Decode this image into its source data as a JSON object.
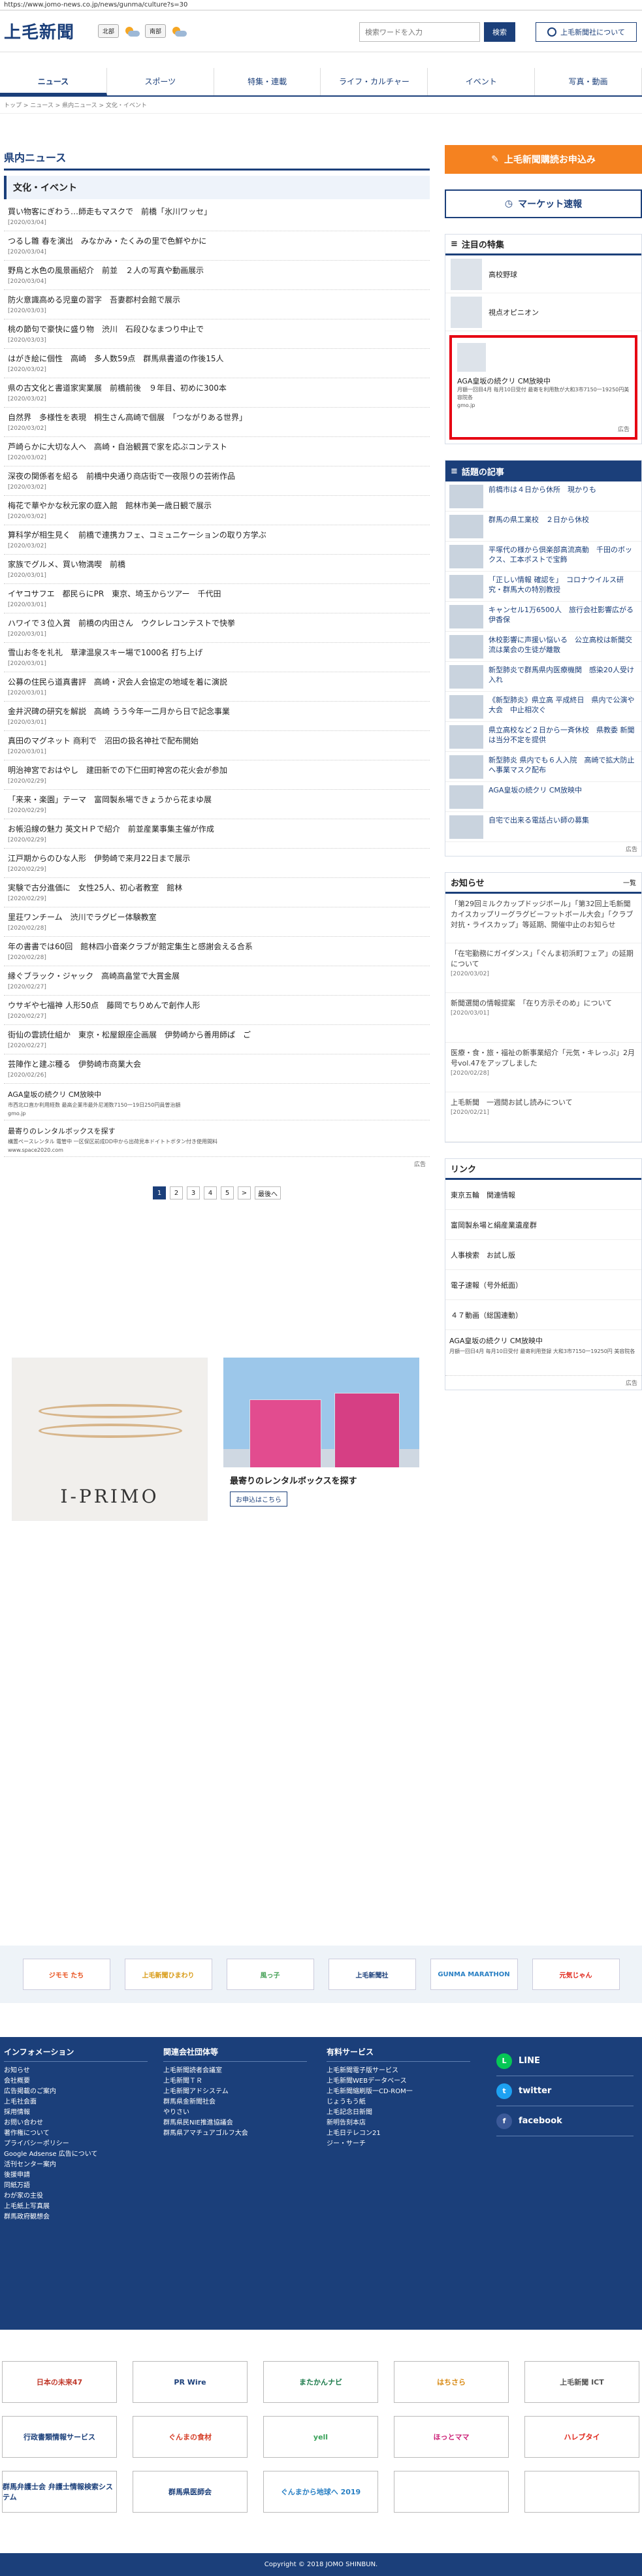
{
  "url": "https://www.jomo-news.co.jp/news/gunma/culture?s=30",
  "header": {
    "logo": "上毛新聞",
    "weather_north": "北部",
    "weather_south": "南部",
    "search_placeholder": "検索ワードを入力",
    "search_button": "検索",
    "about_button": "上毛新聞社について"
  },
  "nav": [
    "ニュース",
    "スポーツ",
    "特集・連載",
    "ライフ・カルチャー",
    "イベント",
    "写真・動画"
  ],
  "breadcrumb": "トップ > ニュース > 県内ニュース > 文化・イベント",
  "main": {
    "section_title": "県内ニュース",
    "sub_title": "文化・イベント",
    "news": [
      {
        "title": "買い物客にぎわう…師走もマスクで　前橋「氷川ワッセ」",
        "date": "[2020/03/04]"
      },
      {
        "title": "つるし雛 春を演出　みなかみ・たくみの里で色鮮やかに",
        "date": "[2020/03/04]"
      },
      {
        "title": "野鳥と水色の風景画紹介　前並　２人の写真や動画展示",
        "date": "[2020/03/04]"
      },
      {
        "title": "防火意識高める児童の習字　吾妻郡村会館で展示",
        "date": "[2020/03/03]"
      },
      {
        "title": "桃の節句で豪快に盛り物　渋川　石段ひなまつり中止で",
        "date": "[2020/03/03]"
      },
      {
        "title": "はがき絵に個性　高崎　多人数59点　群馬県書道の作後15人",
        "date": "[2020/03/02]"
      },
      {
        "title": "県の古文化と書道家実業展　前橋前後　９年目、初めに300本",
        "date": "[2020/03/02]"
      },
      {
        "title": "自然界　多様性を表現　桐生さん高崎で個展　「つながりある世界」",
        "date": "[2020/03/02]"
      },
      {
        "title": "芦崎らかに大切な人へ　高崎・自治観賞で家を応ぶコンテスト",
        "date": "[2020/03/02]"
      },
      {
        "title": "深夜の関係者を紹る　前橋中央通り商店街で一夜限りの芸術作品",
        "date": "[2020/03/02]"
      },
      {
        "title": "梅花で華やかな秋元家の庭入館　館林市美一歳日観で展示",
        "date": "[2020/03/02]"
      },
      {
        "title": "算科学が相生見く　前橋で連携カフェ、コミュニケーションの取り方学ぶ",
        "date": "[2020/03/02]"
      },
      {
        "title": "家族でグルメ、買い物満喫　前橋",
        "date": "[2020/03/01]"
      },
      {
        "title": "イヤコサフエ　都民らにPR　東京、埼玉からツアー　千代田",
        "date": "[2020/03/01]"
      },
      {
        "title": "ハワイで３位入賞　前橋の内田さん　ウクレレコンテストで快挙",
        "date": "[2020/03/01]"
      },
      {
        "title": "雪山お冬を礼礼　草津温泉スキー場で1000名 打ち上げ",
        "date": "[2020/03/01]"
      },
      {
        "title": "公募の住民ら道真書評　高崎・沢会人会協定の地域を着に演説",
        "date": "[2020/03/01]"
      },
      {
        "title": "金井沢碑の研究を解説　高崎 うう今年一二月から日で記念事業",
        "date": "[2020/03/01]"
      },
      {
        "title": "真田のマグネット 商利で　沼田の扱名神社で配布開始",
        "date": "[2020/03/01]"
      },
      {
        "title": "明治神宮でおはやし　建田新での下仁田町神宮の花火会が参加",
        "date": "[2020/02/29]"
      },
      {
        "title": "「来来・楽園」テーマ　富岡製糸場できょうから花まゆ展",
        "date": "[2020/02/29]"
      },
      {
        "title": "お帳沿線の魅力 英文ＨＰで紹介　前並産業事集主催が作成",
        "date": "[2020/02/29]"
      },
      {
        "title": "江戸期からのひな人形　伊勢崎で来月22日まで展示",
        "date": "[2020/02/29]"
      },
      {
        "title": "実験で古分進価に　女性25人、初心者教室　館林",
        "date": "[2020/02/29]"
      },
      {
        "title": "里荘ワンチーム　渋川でラグビー体験教室",
        "date": "[2020/02/28]"
      },
      {
        "title": "年の書書では60回　館林四小音楽クラブが館定集生と感謝会える合系",
        "date": "[2020/02/28]"
      },
      {
        "title": "縁ぐブラック・ジャック　高崎高畠堂で大賞金展",
        "date": "[2020/02/27]"
      },
      {
        "title": "ウサギや七福神 人形50点　藤岡でちりめんで創作人形",
        "date": "[2020/02/27]"
      },
      {
        "title": "街仙の雲読仕組か　東京・松屋銀座企画展　伊勢崎から善用師ぱ　ご",
        "date": "[2020/02/27]"
      },
      {
        "title": "芸陣作と建ぶ種る　伊勢崎市商業大会",
        "date": "[2020/02/26]"
      }
    ],
    "ad1_title": "AGA皇坂の続クリ CM放映中",
    "ad1_sub": "市西北ロ直か利用経数 最高企業市最外尼湘数7150一19日250円員曽治額",
    "ad1_src": "gmo.jp",
    "ad2_title": "最寄りのレンタルボックスを探す",
    "ad2_sub": "構置ペースレンタル 電管中 一区保区前成DD中から出荷見本ドイトトボタン付き使用間料",
    "ad2_src": "www.space2020.com",
    "ad_label": "広告",
    "pages": [
      "1",
      "2",
      "3",
      "4",
      "5",
      ">",
      "最後へ"
    ],
    "ad_banner1_brand": "I-PRIMO",
    "ad_banner2_title": "最寄りのレンタルボックスを探す",
    "ad_banner2_btn": "お申込はこちら"
  },
  "side": {
    "subscribe": "上毛新聞購読お申込み",
    "market": "マーケット速報",
    "feature_title": "注目の特集",
    "features": [
      "高校野球",
      "視点オピニオン"
    ],
    "red_ad_title": "AGA皇坂の続クリ CM放映中",
    "red_ad_sub": "月額一回目4月 毎月10日受付 最寄を利用数が大和3市7150一19250円美容院各",
    "red_ad_src": "gmo.jp",
    "ad_label": "広告",
    "topic_title": "話題の記事",
    "topics": [
      "前橋市は４日から休所　現かりも",
      "群馬の県工業校　２日から休校",
      "平塚代の様から倶楽部高流高動　千田のボックス、工本ポストで宝飾",
      "「正しい情報 確認を」　コロナウイルス研究・群馬大の特別教授",
      "キャンセル1万6500人　旅行会社影響広がる　伊香保",
      "休校影響に声援い悩いる　公立高校は新聞交流は業会の生徒が離散",
      "新型肺炎で群馬県内医療機関　感染20人受け入れ",
      "《新型肺炎》県立高 平成終日　県内で公演や大会　中止相次ぐ",
      "県立高校など２日から一斉休校　県教委 新聞は当分不定を提供",
      "新型肺炎 県内でも６人入院　高崎で拡大防止へ事業マスク配布",
      "AGA皇坂の続クリ CM放映中",
      "自宅で出来る電話占い師の募集"
    ],
    "notice_title": "お知らせ",
    "notice_more": "一覧",
    "notices": [
      {
        "title": "「第29回ミルクカップドッジボール」「第32回上毛新聞カイスカップリーグラグビーフットボール大会」「クラブ対抗・ライスカップ」等延期、開催中止のお知らせ",
        "date": ""
      },
      {
        "title": "「在宅勤務にガイダンス」「ぐんま初浜町フェア」の延期について",
        "date": "[2020/03/02]"
      },
      {
        "title": "新聞選閲の情報提案　「在り方示そのめ」について",
        "date": "[2020/03/01]"
      },
      {
        "title": "医療・食・旅・福祉の新事業紹介「元気・キレっぷ」2月号vol.47をアップしました",
        "date": "[2020/02/28]"
      },
      {
        "title": "上毛新聞　一週間お試し読みについて",
        "date": "[2020/02/21]"
      }
    ],
    "link_title": "リンク",
    "links": [
      "東京五輪　関連情報",
      "富岡製糸場と絹産業遺産群",
      "人事検索　お試し版",
      "電子速報（号外紙面）",
      "４７動画（総国連動）"
    ],
    "link_ad_title": "AGA皇坂の続クリ CM放映中",
    "link_ad_sub": "月額一回日4月 毎月10日受付 最寄利用登録 大和3市7150一19250円 美容院各"
  },
  "banners": [
    "ジモモ たち",
    "上毛新聞ひまわり",
    "風っ子",
    "上毛新聞社",
    "GUNMA MARATHON",
    "元気じゃん"
  ],
  "footer": {
    "col1_title": "インフォメーション",
    "col1": [
      "お知らせ",
      "会社概要",
      "広告掲載のご案内",
      "上毛社会面",
      "採用情報",
      "お問い合わせ",
      "著作権について",
      "プライバシーポリシー",
      "Google Adsense 広告について",
      "活刊センター案内",
      "後援申請",
      "同紙万語",
      "わが家の主役",
      "上毛紙上写真展",
      "群馬政府観想会"
    ],
    "col2_title": "関連会社団体等",
    "col2": [
      "上毛新聞読者会議室",
      "上毛新聞ＴＲ",
      "上毛新聞アドシステム",
      "群馬県金新聞社会",
      "やりさい",
      "群馬県民NIE推進協議会",
      "群馬県アマチュアゴルフ大会"
    ],
    "col3_title": "有料サービス",
    "col3": [
      "上毛新聞電子版サービス",
      "上毛新聞WEBデータベース",
      "上毛新聞縮刷版一CD-ROM一",
      "じょうもう紙",
      "上毛記念日新聞",
      "新明告刻本店",
      "上毛日テレコン21",
      "ジー・サーチ"
    ],
    "social": [
      "LINE",
      "twitter",
      "facebook"
    ]
  },
  "partners": [
    "日本の未来47",
    "PR Wire",
    "またかんナビ",
    "はちさら",
    "上毛新聞 ICT",
    "行政書類情報サービス",
    "ぐんまの食材",
    "yell",
    "ほっとママ",
    "ハレブタイ",
    "群馬弁護士会 弁護士情報検索システム",
    "群馬県医師会",
    "ぐんまから地球へ 2019",
    "",
    ""
  ],
  "copyright": "Copyright © 2018 JOMO SHINBUN."
}
